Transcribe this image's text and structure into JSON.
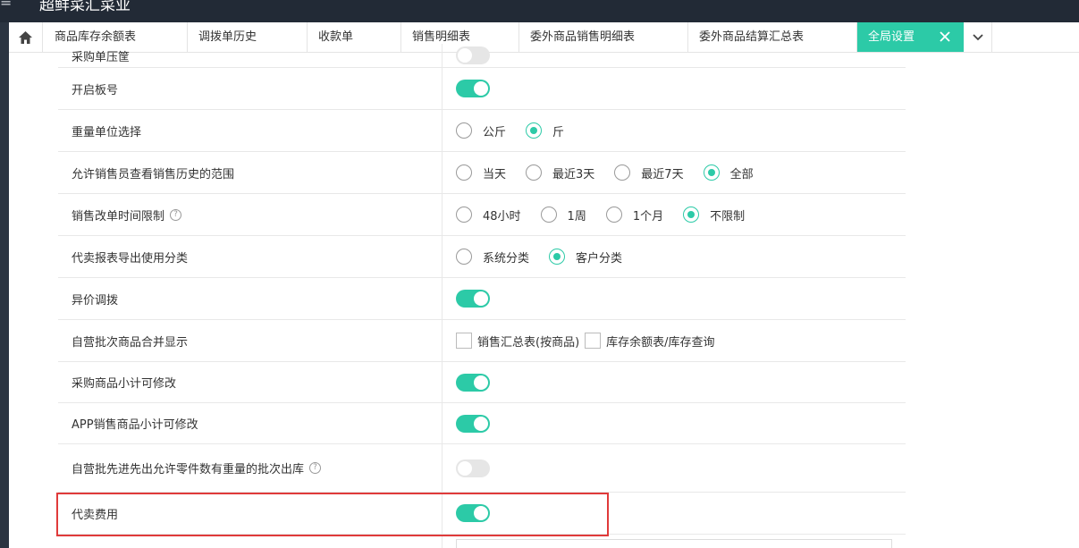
{
  "app": {
    "title": "超鲜菜汇菜业",
    "menu_glyph": "≡"
  },
  "tabs": [
    {
      "label": "商品库存余额表",
      "active": false
    },
    {
      "label": "调拨单历史",
      "active": false
    },
    {
      "label": "收款单",
      "active": false
    },
    {
      "label": "销售明细表",
      "active": false
    },
    {
      "label": "委外商品销售明细表",
      "active": false
    },
    {
      "label": "委外商品结算汇总表",
      "active": false
    },
    {
      "label": "全局设置",
      "active": true
    }
  ],
  "icons": {
    "home": "home-icon",
    "close": "close-icon",
    "more": "chevron-down-icon",
    "help": "question-circle-icon"
  },
  "help_glyph": "?",
  "colors": {
    "accent": "#2ccaa7",
    "topbar": "#222a36",
    "highlight": "#e03a3a"
  },
  "settings": [
    {
      "label": "采购单压筐",
      "type": "switch",
      "on": false
    },
    {
      "label": "开启板号",
      "type": "switch",
      "on": true
    },
    {
      "label": "重量单位选择",
      "type": "radio",
      "options": [
        "公斤",
        "斤"
      ],
      "selected": "斤"
    },
    {
      "label": "允许销售员查看销售历史的范围",
      "type": "radio",
      "options": [
        "当天",
        "最近3天",
        "最近7天",
        "全部"
      ],
      "selected": "全部"
    },
    {
      "label": "销售改单时间限制",
      "help": true,
      "type": "radio",
      "options": [
        "48小时",
        "1周",
        "1个月",
        "不限制"
      ],
      "selected": "不限制"
    },
    {
      "label": "代卖报表导出使用分类",
      "type": "radio",
      "options": [
        "系统分类",
        "客户分类"
      ],
      "selected": "客户分类"
    },
    {
      "label": "异价调拨",
      "type": "switch",
      "on": true
    },
    {
      "label": "自营批次商品合并显示",
      "type": "checkbox",
      "options": [
        "销售汇总表(按商品)",
        "库存余额表/库存查询"
      ]
    },
    {
      "label": "采购商品小计可修改",
      "type": "switch",
      "on": true
    },
    {
      "label": "APP销售商品小计可修改",
      "type": "switch",
      "on": true
    },
    {
      "label": "自营批先进先出允许零件数有重量的批次出库",
      "help": true,
      "type": "switch",
      "on": false
    },
    {
      "label": "代卖费用",
      "type": "switch",
      "on": true,
      "highlighted": true
    }
  ]
}
